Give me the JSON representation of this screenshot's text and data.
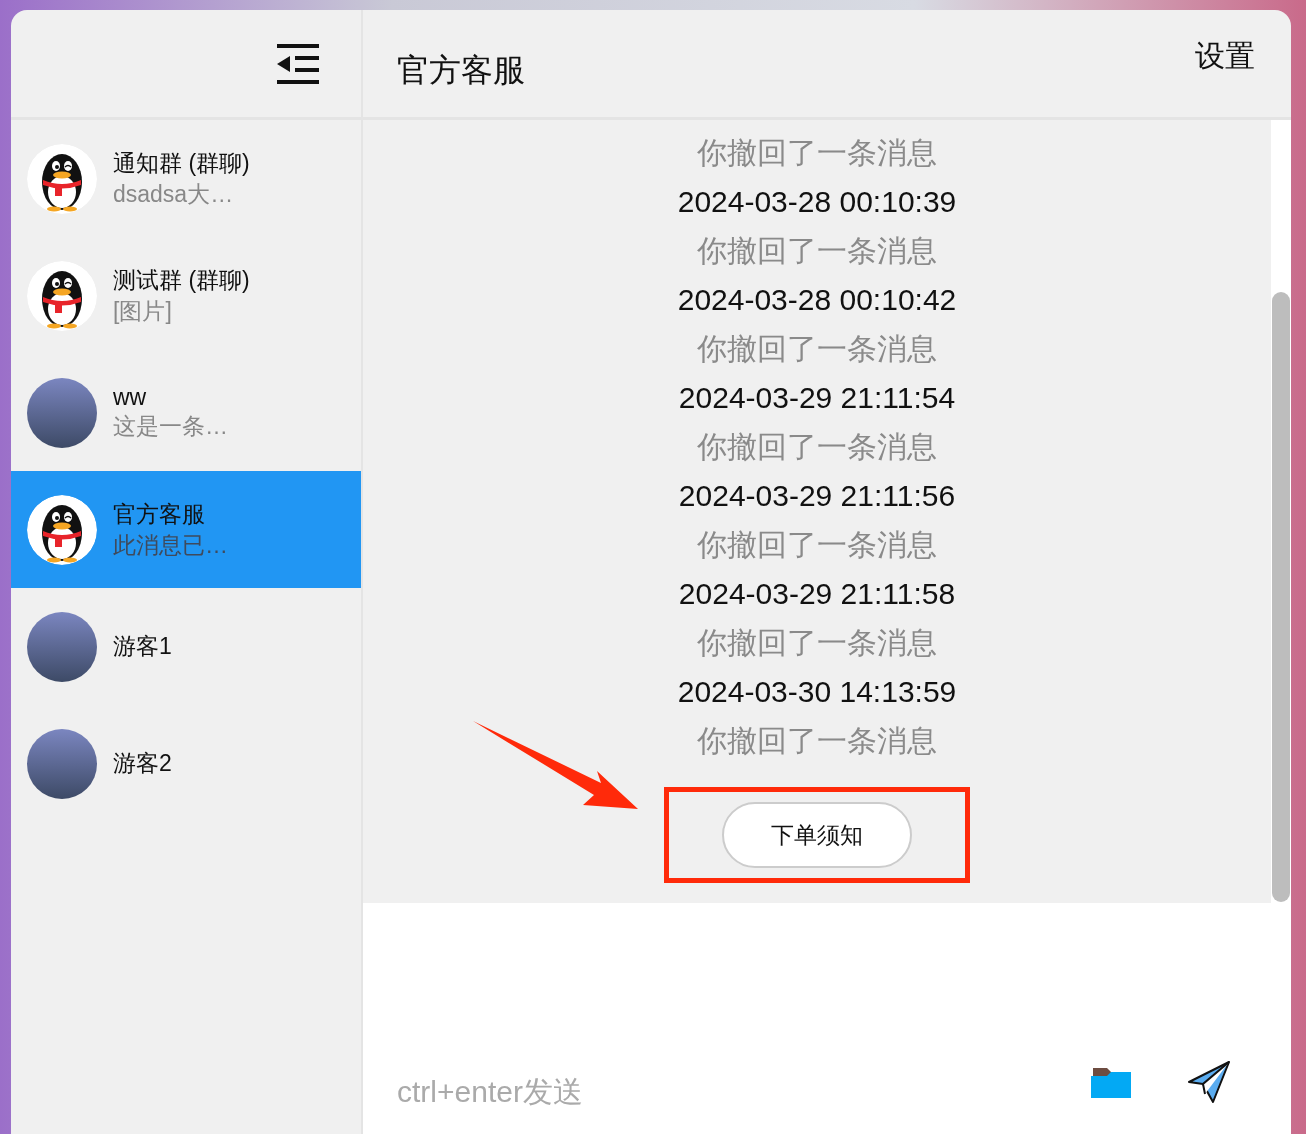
{
  "sidebar": {
    "items": [
      {
        "name": "通知群 (群聊)",
        "preview": "dsadsa大…",
        "kind": "penguin",
        "selected": false
      },
      {
        "name": "测试群 (群聊)",
        "preview": "[图片]",
        "kind": "penguin",
        "selected": false
      },
      {
        "name": "ww",
        "preview": "这是一条…",
        "kind": "photo",
        "selected": false
      },
      {
        "name": "官方客服",
        "preview": "此消息已…",
        "kind": "penguin",
        "selected": true
      },
      {
        "name": "游客1",
        "kind": "photo",
        "selected": false
      },
      {
        "name": "游客2",
        "kind": "photo",
        "selected": false
      }
    ]
  },
  "header": {
    "title": "官方客服",
    "settings": "设置"
  },
  "messages": [
    {
      "kind": "notice",
      "text": "你撤回了一条消息"
    },
    {
      "kind": "time",
      "text": "2024-03-28 00:10:39"
    },
    {
      "kind": "notice",
      "text": "你撤回了一条消息"
    },
    {
      "kind": "time",
      "text": "2024-03-28 00:10:42"
    },
    {
      "kind": "notice",
      "text": "你撤回了一条消息"
    },
    {
      "kind": "time",
      "text": "2024-03-29 21:11:54"
    },
    {
      "kind": "notice",
      "text": "你撤回了一条消息"
    },
    {
      "kind": "time",
      "text": "2024-03-29 21:11:56"
    },
    {
      "kind": "notice",
      "text": "你撤回了一条消息"
    },
    {
      "kind": "time",
      "text": "2024-03-29 21:11:58"
    },
    {
      "kind": "notice",
      "text": "你撤回了一条消息"
    },
    {
      "kind": "time",
      "text": "2024-03-30 14:13:59"
    },
    {
      "kind": "notice",
      "text": "你撤回了一条消息"
    }
  ],
  "quick_button": "下单须知",
  "composer": {
    "placeholder": "ctrl+enter发送"
  }
}
